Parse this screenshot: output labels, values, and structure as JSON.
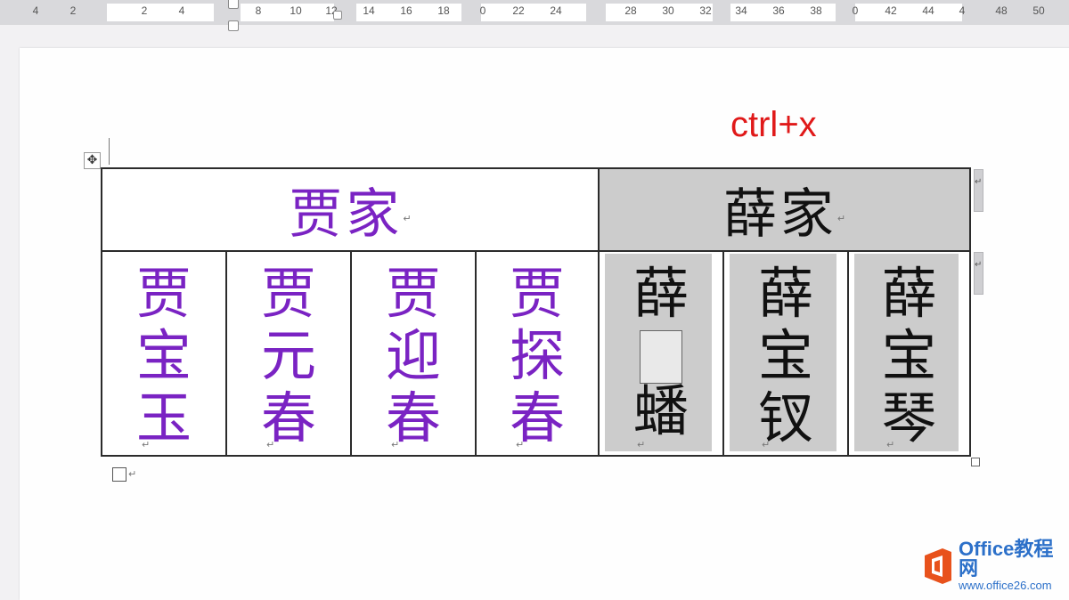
{
  "ruler": {
    "numbers": [
      "4",
      "2",
      "2",
      "4",
      "8",
      "10",
      "12",
      "14",
      "16",
      "18",
      "0",
      "22",
      "24",
      "28",
      "30",
      "32",
      "34",
      "36",
      "38",
      "0",
      "42",
      "44",
      "4",
      "48",
      "50"
    ]
  },
  "annotation": "ctrl+x",
  "table": {
    "header_jia": "贾家",
    "header_xue": "薛家",
    "jia_members": [
      [
        "贾",
        "宝",
        "玉"
      ],
      [
        "贾",
        "元",
        "春"
      ],
      [
        "贾",
        "迎",
        "春"
      ],
      [
        "贾",
        "探",
        "春"
      ]
    ],
    "xue_members": [
      [
        "薛",
        "",
        "蟠"
      ],
      [
        "薛",
        "宝",
        "钗"
      ],
      [
        "薛",
        "宝",
        "琴"
      ]
    ]
  },
  "paragraph_mark": "↵",
  "colors": {
    "jia_text": "#7a23c3",
    "xue_shade": "#cccccc",
    "annotation": "#e01919",
    "logo": "#2c70c9"
  },
  "logo": {
    "name": "Office教程网",
    "url": "www.office26.com"
  }
}
